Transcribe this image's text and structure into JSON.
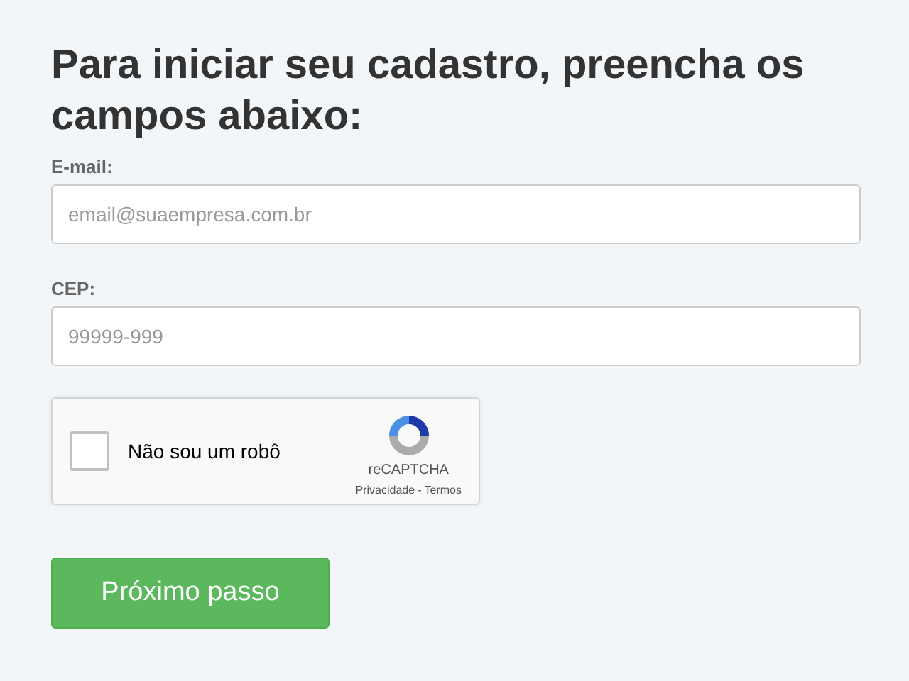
{
  "heading": "Para iniciar seu cadastro, preencha os campos abaixo:",
  "fields": [
    {
      "label": "E-mail:",
      "placeholder": "email@suaempresa.com.br"
    },
    {
      "label": "CEP:",
      "placeholder": "99999-999"
    }
  ],
  "captcha": {
    "label": "Não sou um robô",
    "checked": false,
    "brand": "reCAPTCHA",
    "privacy": "Privacidade",
    "separator": "-",
    "terms": "Termos"
  },
  "submit": "Próximo passo"
}
